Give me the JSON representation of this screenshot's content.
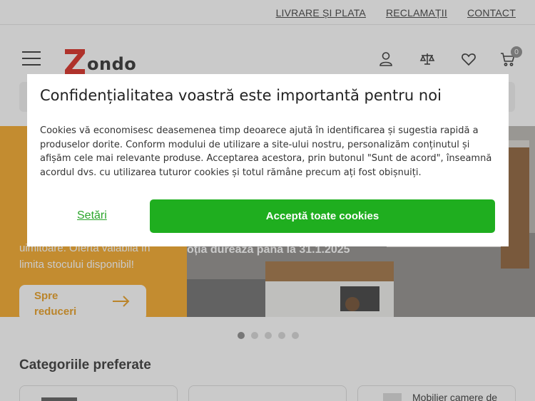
{
  "topbar": {
    "links": [
      "LIVRARE ȘI PLATA",
      "RECLAMAȚII",
      "CONTACT"
    ]
  },
  "header": {
    "logo_text": "ondo",
    "cart_count": "0",
    "icons": [
      "menu-icon",
      "user-icon",
      "compare-icon",
      "heart-icon",
      "cart-icon"
    ]
  },
  "banner": {
    "left_text": "uimitoare. Ofertă valabilă în limita stocului disponibil!",
    "cta_label": "Spre reduceri",
    "promo_text": "oția durează până la 31.1.2025"
  },
  "carousel": {
    "active_index": 0,
    "count": 5
  },
  "categories": {
    "title": "Categoriile preferate",
    "visible_label": "Mobilier camere de"
  },
  "cookie_modal": {
    "title": "Confidențialitatea voastră este importantă pentru noi",
    "body": "Cookies vă economisesc deasemenea timp deoarece ajută în identificarea și sugestia rapidă a produselor dorite. Conform modului de utilizare a site-ului nostru, personalizăm conținutul și afișăm cele mai relevante produse. Acceptarea acestora, prin butonul \"Sunt de acord\", înseamnă acordul dvs. cu utilizarea tuturor cookies și totul rămâne precum ați fost obișnuiți.",
    "settings_label": "Setări",
    "accept_label": "Acceptă toate cookies"
  },
  "colors": {
    "accent_green": "#1fae1f",
    "banner_orange": "#f5a623",
    "logo_red": "#d9261c"
  }
}
